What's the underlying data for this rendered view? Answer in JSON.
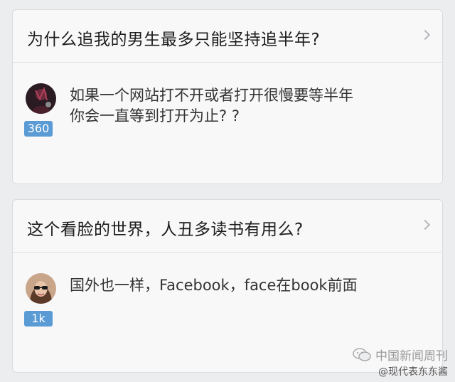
{
  "questions": [
    {
      "title": "为什么追我的男生最多只能坚持追半年?",
      "answer_lines": [
        "如果一个网站打不开或者打开很慢要等半年",
        "你会一直等到打开为止? ?"
      ],
      "vote_badge": "360"
    },
    {
      "title": "这个看脸的世界，人丑多读书有用么?",
      "answer_lines": [
        "国外也一样，Facebook，face在book前面"
      ],
      "vote_badge": "1k"
    }
  ],
  "watermark": {
    "source": "中国新闻周刊",
    "handle": "@现代表东东酱"
  },
  "colors": {
    "badge": "#5a9bd5",
    "card_bg": "#f8f8f9",
    "page_bg": "#ecedef"
  },
  "icons": [
    "chevron-right-icon",
    "wechat-icon"
  ]
}
